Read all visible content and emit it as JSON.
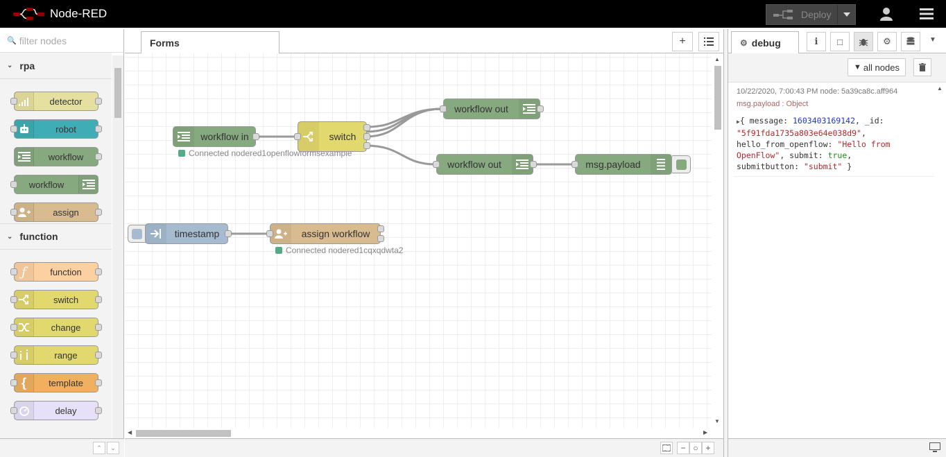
{
  "header": {
    "app_title": "Node-RED",
    "deploy_label": "Deploy"
  },
  "palette": {
    "filter_placeholder": "filter nodes",
    "categories": [
      {
        "name": "rpa",
        "nodes": [
          "detector",
          "robot",
          "workflow",
          "workflow",
          "assign"
        ]
      },
      {
        "name": "function",
        "nodes": [
          "function",
          "switch",
          "change",
          "range",
          "template",
          "delay"
        ]
      }
    ]
  },
  "workspace": {
    "tab_label": "Forms",
    "nodes": {
      "workflow_in": "workflow in",
      "switch": "switch",
      "workflow_out_1": "workflow out",
      "workflow_out_2": "workflow out",
      "msg_payload": "msg.payload",
      "timestamp": "timestamp",
      "assign_workflow": "assign workflow"
    },
    "status": {
      "workflow_in": "Connected nodered1openflowformsexample",
      "assign_workflow": "Connected nodered1cqxqdwta2"
    }
  },
  "sidebar": {
    "tab_label": "debug",
    "filter_label": "all nodes",
    "message": {
      "meta": "10/22/2020, 7:00:43 PM    node: 5a39ca8c.aff964",
      "topic": "msg.payload : Object",
      "open": "{ message: ",
      "message_val": "1603403169142",
      "id_key": ", _id: ",
      "id_val": "\"5f91fda1735a803e64e038d9\"",
      "comma1": ",",
      "hello_key": "hello_from_openflow: ",
      "hello_val": "\"Hello from OpenFlow\"",
      "submit_key": ", submit: ",
      "submit_val": "true",
      "comma2": ",",
      "sb_key": "submitbutton: ",
      "sb_val": "\"submit\"",
      "close": " }"
    }
  },
  "colors": {
    "header_bg": "#000000",
    "workflow_node": "#87a980",
    "switch_node": "#e2d96e",
    "assign_node": "#d8bb8f",
    "timestamp_node": "#a6bbcf",
    "robot_node": "#3fadb5",
    "detector_node": "#e6e0a0",
    "function_node": "#fdd0a2",
    "template_node": "#f0b060",
    "delay_node": "#e6e0f8"
  }
}
